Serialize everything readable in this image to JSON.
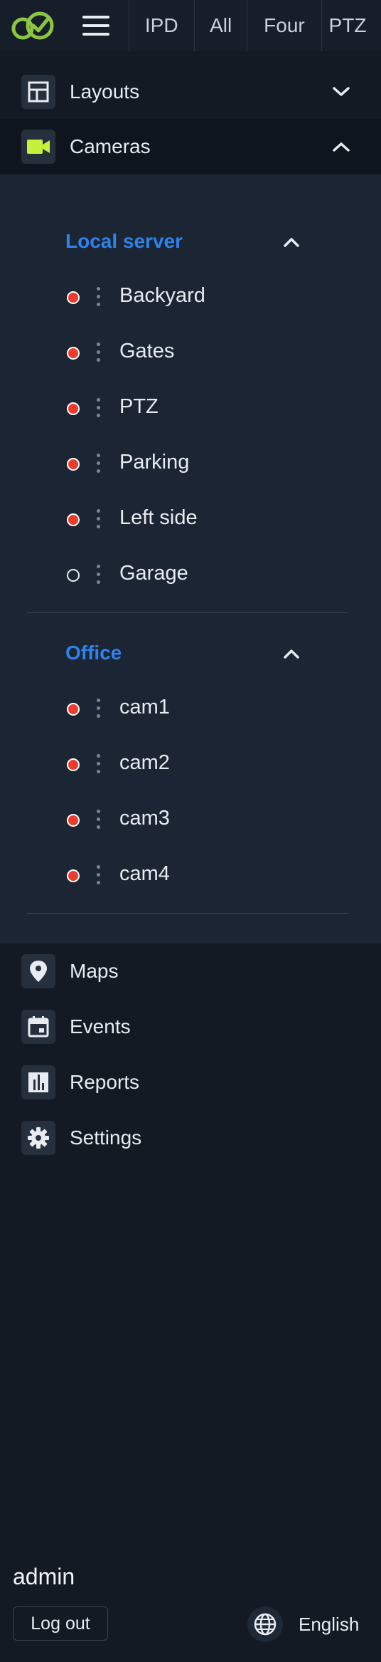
{
  "topbar": {
    "tabs": [
      "IPD",
      "All",
      "Four",
      "PTZ"
    ]
  },
  "nav": {
    "layouts": "Layouts",
    "cameras": "Cameras",
    "maps": "Maps",
    "events": "Events",
    "reports": "Reports",
    "settings": "Settings"
  },
  "groups": [
    {
      "name": "Local server",
      "cameras": [
        {
          "name": "Backyard",
          "status": "online"
        },
        {
          "name": "Gates",
          "status": "online"
        },
        {
          "name": "PTZ",
          "status": "online"
        },
        {
          "name": "Parking",
          "status": "online"
        },
        {
          "name": "Left side",
          "status": "online"
        },
        {
          "name": "Garage",
          "status": "offline"
        }
      ]
    },
    {
      "name": "Office",
      "cameras": [
        {
          "name": "cam1",
          "status": "online"
        },
        {
          "name": "cam2",
          "status": "online"
        },
        {
          "name": "cam3",
          "status": "online"
        },
        {
          "name": "cam4",
          "status": "online"
        }
      ]
    }
  ],
  "footer": {
    "user": "admin",
    "logout": "Log out",
    "language": "English"
  },
  "colors": {
    "accent": "#2f82e9",
    "camera_icon": "#c5f03c",
    "logo": "#8cc640",
    "status_online": "#ef3b2c"
  },
  "icons": [
    "logo-icon",
    "hamburger-menu-icon",
    "layout-grid-icon",
    "video-camera-icon",
    "chevron-down-icon",
    "chevron-up-icon",
    "map-pin-icon",
    "calendar-icon",
    "bar-chart-icon",
    "gear-icon",
    "globe-icon"
  ]
}
